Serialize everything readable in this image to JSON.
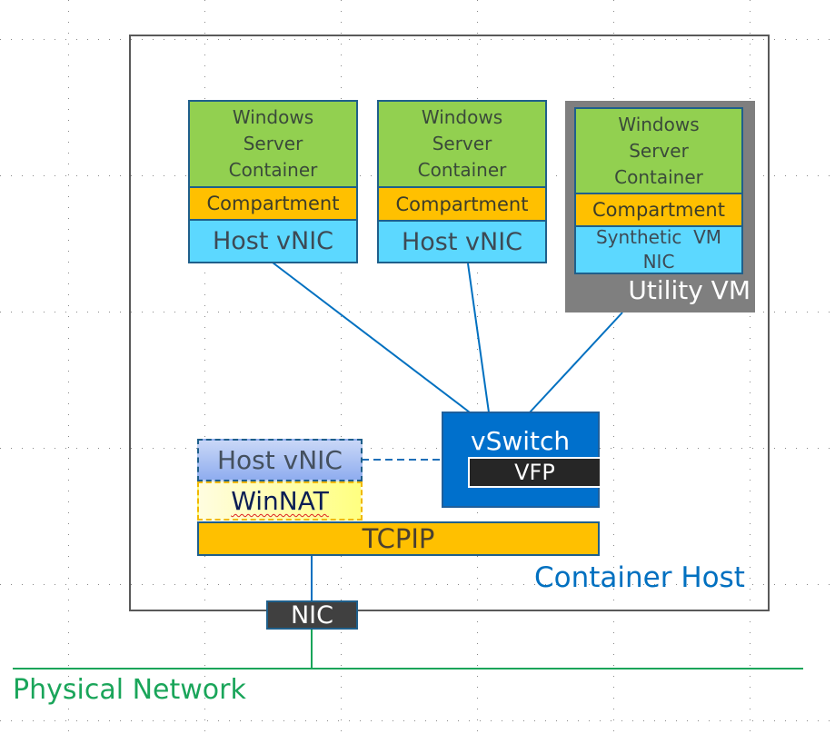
{
  "diagram": {
    "containers": [
      {
        "workload": "Windows Server Container",
        "lines": [
          "Windows",
          "Server",
          "Container"
        ],
        "compartment": "Compartment",
        "nic": "Host vNIC"
      },
      {
        "workload": "Windows Server Container",
        "lines": [
          "Windows",
          "Server",
          "Container"
        ],
        "compartment": "Compartment",
        "nic": "Host vNIC"
      },
      {
        "workload": "Windows Server Container",
        "lines": [
          "Windows",
          "Server",
          "Container"
        ],
        "compartment": "Compartment",
        "nic_lines": [
          "Synthetic  VM",
          "NIC"
        ]
      }
    ],
    "utility_vm_label": "Utility VM",
    "vswitch_label": "vSwitch",
    "vfp_label": "VFP",
    "host_vnic_label": "Host vNIC",
    "winnat_label": "WinNAT",
    "tcpip_label": "TCPIP",
    "container_host_label": "Container Host",
    "nic_label": "NIC",
    "physical_network_label": "Physical Network",
    "colors": {
      "container": "#92d050",
      "compartment": "#ffc000",
      "vnic": "#5cd8ff",
      "utility_vm": "#7f7f7f",
      "vswitch": "#0070cc",
      "vfp": "#262626",
      "tcpip": "#ffc000",
      "nic": "#404040",
      "link": "#0070c0",
      "physical_network": "#1aa55a",
      "container_host_label": "#0070c0"
    }
  }
}
